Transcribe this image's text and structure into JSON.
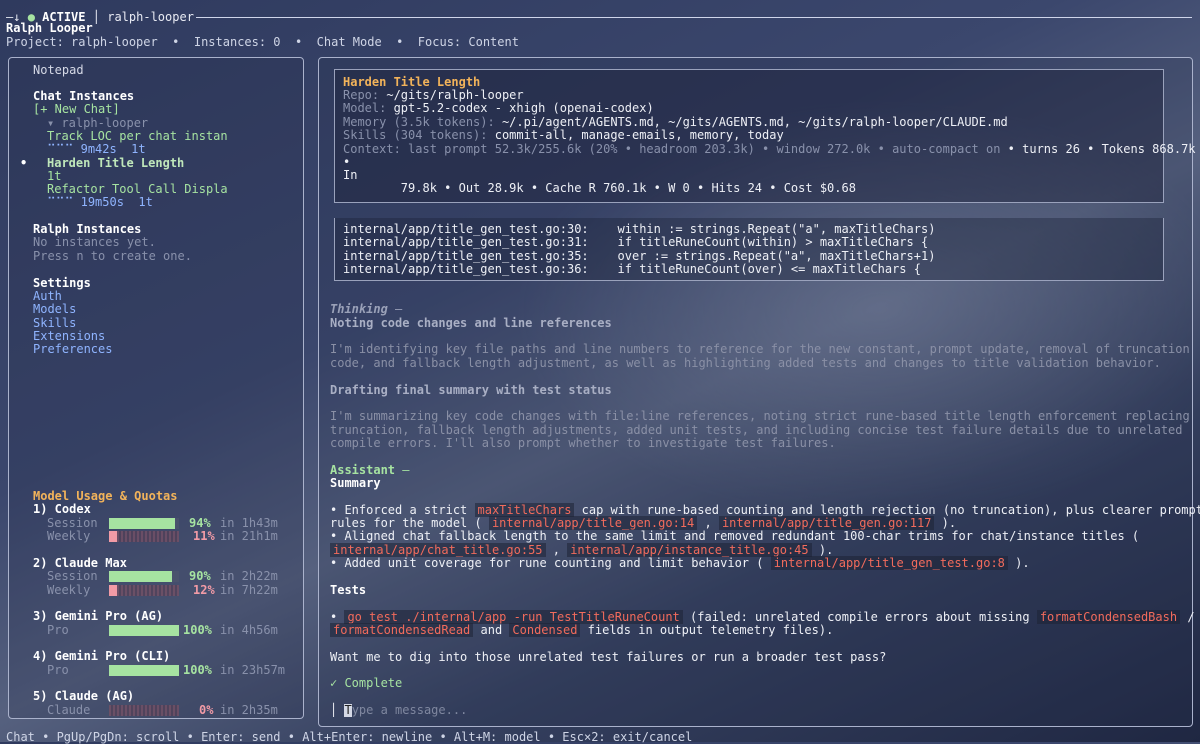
{
  "topbar": {
    "prefix": "—↓",
    "status_dot": "●",
    "status": "ACTIVE",
    "separator": "│",
    "session_name": "ralph-looper"
  },
  "app": {
    "title": "Ralph Looper",
    "status_line": "Project: ralph-looper  •  Instances: 0  •  Chat Mode  •  Focus: Content"
  },
  "sidebar": {
    "notepad": "Notepad",
    "chat_instances_title": "Chat Instances",
    "new_chat": "[+ New Chat]",
    "tree_root": "▾ ralph-looper",
    "chats": [
      {
        "bullet": "",
        "title": "Track LOC per chat instan",
        "meta": "⠉⠉⠉ 9m42s  1t"
      },
      {
        "bullet": "•",
        "title": "Harden Title Length",
        "meta": "1t"
      },
      {
        "bullet": "",
        "title": "Refactor Tool Call Displa",
        "meta": "⠉⠉⠉ 19m50s  1t"
      }
    ],
    "ralph_title": "Ralph Instances",
    "ralph_empty_1": "No instances yet.",
    "ralph_empty_2": "Press n to create one.",
    "settings_title": "Settings",
    "settings_items": [
      "Auth",
      "Models",
      "Skills",
      "Extensions",
      "Preferences"
    ],
    "usage_title": "Model Usage & Quotas",
    "providers": [
      {
        "label": "1) Codex",
        "rows": [
          {
            "name": "Session",
            "pct": "94%",
            "value": 0.94,
            "reset": "in 1h43m",
            "color": "green"
          },
          {
            "name": "Weekly",
            "pct": "11%",
            "value": 0.11,
            "reset": "in 21h1m",
            "color": "pink"
          }
        ]
      },
      {
        "label": "2) Claude Max",
        "rows": [
          {
            "name": "Session",
            "pct": "90%",
            "value": 0.9,
            "reset": "in 2h22m",
            "color": "green"
          },
          {
            "name": "Weekly",
            "pct": "12%",
            "value": 0.12,
            "reset": "in 7h22m",
            "color": "pink"
          }
        ]
      },
      {
        "label": "3) Gemini Pro (AG)",
        "rows": [
          {
            "name": "Pro",
            "pct": "100%",
            "value": 1.0,
            "reset": "in 4h56m",
            "color": "green"
          }
        ]
      },
      {
        "label": "4) Gemini Pro (CLI)",
        "rows": [
          {
            "name": "Pro",
            "pct": "100%",
            "value": 1.0,
            "reset": "in 23h57m",
            "color": "green"
          }
        ]
      },
      {
        "label": "5) Claude (AG)",
        "rows": [
          {
            "name": "Claude",
            "pct": "0%",
            "value": 0.0,
            "reset": "in 2h35m",
            "color": "pink"
          }
        ]
      }
    ]
  },
  "info": {
    "title": "Harden Title Length",
    "repo_label": "Repo: ",
    "repo": "~/gits/ralph-looper",
    "model_label": "Model: ",
    "model": "gpt-5.2-codex - xhigh (openai-codex)",
    "memory_label": "Memory (3.5k tokens): ",
    "memory": "~/.pi/agent/AGENTS.md, ~/gits/AGENTS.md, ~/gits/ralph-looper/CLAUDE.md",
    "skills_label": "Skills (304 tokens): ",
    "skills": "commit-all, manage-emails, memory, today",
    "context_dim": "Context: last prompt 52.3k/255.6k (20% • headroom 203.3k) • window 272.0k • auto-compact on",
    "context_bright": " • turns 26 • Tokens 868.7k",
    "bullet_line": "•",
    "in_label": "In",
    "stats": "        79.8k • Out 28.9k • Cache R 760.1k • W 0 • Hits 24 • Cost $0.68"
  },
  "code_lines": [
    "internal/app/title_gen_test.go:30:    within := strings.Repeat(\"a\", maxTitleChars)",
    "internal/app/title_gen_test.go:31:    if titleRuneCount(within) > maxTitleChars {",
    "internal/app/title_gen_test.go:35:    over := strings.Repeat(\"a\", maxTitleChars+1)",
    "internal/app/title_gen_test.go:36:    if titleRuneCount(over) <= maxTitleChars {"
  ],
  "thinking": {
    "label": "Thinking",
    "dash": " —",
    "heading1": "Noting code changes and line references",
    "body1": [
      "I'm identifying key file paths and line numbers to reference for the new constant, prompt update, removal of truncation",
      "code, and fallback length adjustment, as well as highlighting added tests and changes to title validation behavior."
    ],
    "heading2": "Drafting final summary with test status",
    "body2": [
      "I'm summarizing key code changes with file:line references, noting strict rune-based title length enforcement replacing",
      "truncation, fallback length adjustments, added unit tests, and including concise test failure details due to unrelated",
      "compile errors. I'll also prompt whether to investigate test failures."
    ]
  },
  "assistant": {
    "label": "Assistant",
    "dash": " —",
    "summary_heading": "Summary",
    "b1_pre": "• Enforced a strict ",
    "b1_code": "maxTitleChars",
    "b1_post": " cap with rune-based counting and length rejection (no truncation), plus clearer prompt",
    "b1_line2_pre": "rules for the model ( ",
    "b1_ref1": "internal/app/title_gen.go:14",
    "b1_mid": " , ",
    "b1_ref2": "internal/app/title_gen.go:117",
    "b1_end": " ).",
    "b2_line1": "• Aligned chat fallback length to the same limit and removed redundant 100-char trims for chat/instance titles (",
    "b2_ref1": "internal/app/chat_title.go:55",
    "b2_mid": " , ",
    "b2_ref2": "internal/app/instance_title.go:45",
    "b2_end": " ).",
    "b3_pre": "• Added unit coverage for rune counting and limit behavior ( ",
    "b3_ref": "internal/app/title_gen_test.go:8",
    "b3_end": " ).",
    "tests_heading": "Tests",
    "t_pre": "• ",
    "t_cmd": "go test ./internal/app -run TestTitleRuneCount",
    "t_mid": " (failed: unrelated compile errors about missing ",
    "t_ref1": "formatCondensedBash",
    "t_slash": " /",
    "t_ref2": "formatCondensedRead",
    "t_and": " and ",
    "t_ref3": "Condensed",
    "t_end": " fields in output telemetry files).",
    "question": "Want me to dig into those unrelated test failures or run a broader test pass?",
    "complete": "✓ Complete"
  },
  "input": {
    "bar": "│",
    "cursor_char": "T",
    "placeholder": "ype a message..."
  },
  "footer": {
    "hints": "Chat • PgUp/PgDn: scroll • Enter: send • Alt+Enter: newline • Alt+M: model • Esc×2: exit/cancel"
  }
}
